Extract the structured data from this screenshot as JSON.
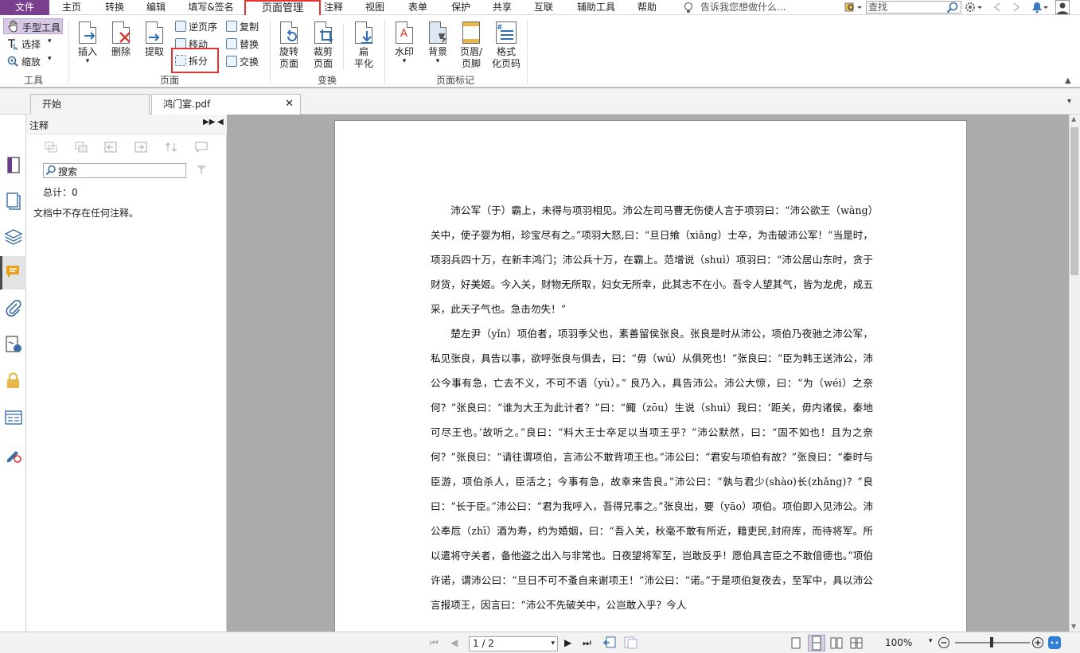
{
  "menu": {
    "file": "文件",
    "items": [
      "主页",
      "转换",
      "编辑",
      "填写&签名",
      "页面管理",
      "注释",
      "视图",
      "表单",
      "保护",
      "共享",
      "互联",
      "辅助工具",
      "帮助"
    ],
    "active": "页面管理",
    "tell_me": "告诉我您想做什么...",
    "search_placeholder": "查找"
  },
  "ribbon": {
    "tools": {
      "hand": "手型工具",
      "select": "选择",
      "zoom": "缩放",
      "group": "工具"
    },
    "page": {
      "insert": "插入",
      "delete": "删除",
      "extract": "提取",
      "reverse": "逆页序",
      "move": "移动",
      "split": "拆分",
      "copy": "复制",
      "replace": "替换",
      "swap": "交换",
      "group": "页面"
    },
    "transform": {
      "rotate": [
        "旋转",
        "页面"
      ],
      "crop": [
        "裁剪",
        "页面"
      ],
      "flatten": [
        "扁",
        "平化"
      ],
      "group": "变换"
    },
    "marks": {
      "watermark": "水印",
      "background": "背景",
      "header_footer": [
        "页眉/",
        "页脚"
      ],
      "format": [
        "格式",
        "化页码"
      ],
      "group": "页面标记"
    }
  },
  "tabs": [
    {
      "label": "开始"
    },
    {
      "label": "鸿门宴.pdf"
    }
  ],
  "panel": {
    "title": "注释",
    "search_placeholder": "搜索",
    "total": "总计：0",
    "empty_message": "文档中不存在任何注释。"
  },
  "document": {
    "paragraphs": [
      "沛公军（于）霸上，未得与项羽相见。沛公左司马曹无伤使人言于项羽曰：“沛公欲王（wàng）关中，使子婴为相，珍宝尽有之。”项羽大怒,曰：“旦日飨（xiǎng）士卒，为击破沛公军！”当是时，项羽兵四十万，在新丰鸿门；沛公兵十万，在霸上。范增说（shuì）项羽曰：“沛公居山东时，贪于财货，好美姬。今入关，财物无所取，妇女无所幸，此其志不在小。吾令人望其气，皆为龙虎，成五采，此天子气也。急击勿失！”",
      "楚左尹（yǐn）项伯者，项羽季父也，素善留侯张良。张良是时从沛公，项伯乃夜驰之沛公军，私见张良，具告以事，欲呼张良与俱去，曰：“毋（wú）从俱死也！”张良曰：“臣为韩王送沛公，沛公今事有急，亡去不义，不可不语（yù）。” 良乃入，具告沛公。沛公大惊，曰：“为（wéi）之奈何？”张良曰：“谁为大王为此计者？”曰：“鲰（zōu）生说（shuì）我曰：‘距关，毋内诸侯，秦地可尽王也。’故听之。”良曰：“料大王士卒足以当项王乎？”沛公默然，曰：“固不如也！且为之奈何？”张良曰：“请往谓项伯，言沛公不敢背项王也。”沛公曰：“君安与项伯有故？”张良曰：“秦时与臣游，项伯杀人，臣活之；今事有急，故幸来告良。”沛公曰：“孰与君少(shào)长(zhǎng)？”良曰：“长于臣。”沛公曰：“君为我呼入，吾得兄事之。”张良出，要（yāo）项伯。项伯即入见沛公。沛公奉卮（zhī）酒为寿，约为婚姻，曰：“吾入关，秋毫不敢有所近，籍吏民,封府库，而待将军。所以遣将守关者，备他盗之出入与非常也。日夜望将军至，岂敢反乎！愿伯具言臣之不敢倍德也。”项伯许诺，谓沛公曰：“旦日不可不蚤自来谢项王！”沛公曰：“诺。”于是项伯复夜去，至军中，具以沛公言报项王，因言曰：“沛公不先破关中，公岂敢入乎？今人"
    ]
  },
  "status": {
    "page_value": "1 / 2",
    "zoom": "100%"
  },
  "colors": {
    "accent": "#7a3f8f",
    "highlight": "#e53333"
  }
}
